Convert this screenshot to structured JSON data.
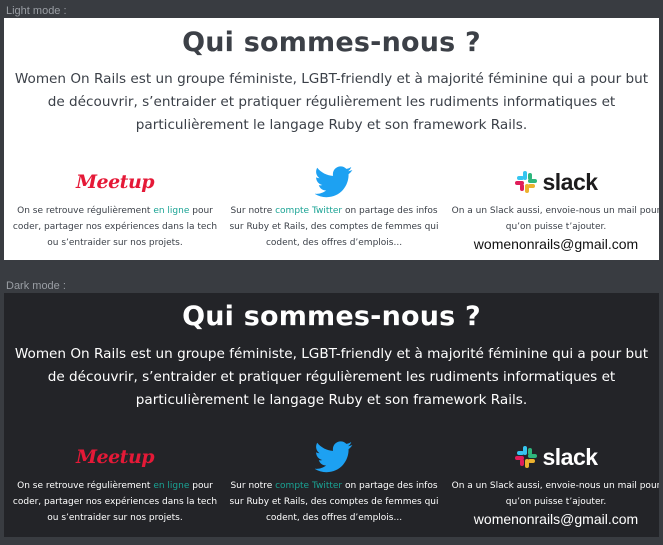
{
  "light": {
    "mode_label": "Light mode :",
    "title": "Qui sommes-nous ?",
    "intro": "Women On Rails est un groupe féministe, LGBT-friendly et à majorité féminine qui a pour but de découvrir, s’entraider et pratiquer régulièrement les rudiments informatiques et particulièrement le langage Ruby et son framework Rails.",
    "meetup": {
      "logo_text": "Meetup",
      "text_before": "On se retrouve régulièrement ",
      "link": "en ligne",
      "text_after": " pour coder, partager nos expériences dans la tech ou s’entraider sur nos projets."
    },
    "twitter": {
      "icon": "twitter-bird-icon",
      "text_before": "Sur notre ",
      "link": "compte Twitter",
      "text_after": " on partage des infos sur Ruby et Rails, des comptes de femmes qui codent, des offres d’emplois..."
    },
    "slack": {
      "logo_text": "slack",
      "text": "On a un Slack aussi, envoie-nous un mail pour qu’on puisse t’ajouter.",
      "email": "womenonrails@gmail.com"
    }
  },
  "dark": {
    "mode_label": "Dark mode :",
    "title": "Qui sommes-nous ?",
    "intro": "Women On Rails est un groupe féministe, LGBT-friendly et à majorité féminine qui a pour but de découvrir, s’entraider et pratiquer régulièrement les rudiments informatiques et particulièrement le langage Ruby et son framework Rails.",
    "meetup": {
      "logo_text": "Meetup",
      "text_before": "On se retrouve régulièrement ",
      "link": "en ligne",
      "text_after": " pour coder, partager nos expériences dans la tech ou s’entraider sur nos projets."
    },
    "twitter": {
      "icon": "twitter-bird-icon",
      "text_before": "Sur notre ",
      "link": "compte Twitter",
      "text_after": " on partage des infos sur Ruby et Rails, des comptes de femmes qui codent, des offres d’emplois..."
    },
    "slack": {
      "logo_text": "slack",
      "text": "On a un Slack aussi, envoie-nous un mail pour qu’on puisse t’ajouter.",
      "email": "womenonrails@gmail.com"
    }
  },
  "colors": {
    "page_bg": "#393c41",
    "light_bg": "#ffffff",
    "dark_bg": "#232428",
    "link": "#1aa394",
    "meetup_red": "#e51937",
    "twitter_blue": "#1da1f2",
    "slack_blue": "#36c5f0",
    "slack_green": "#2eb67d",
    "slack_yellow": "#ecb22e",
    "slack_red": "#e01e5a"
  }
}
